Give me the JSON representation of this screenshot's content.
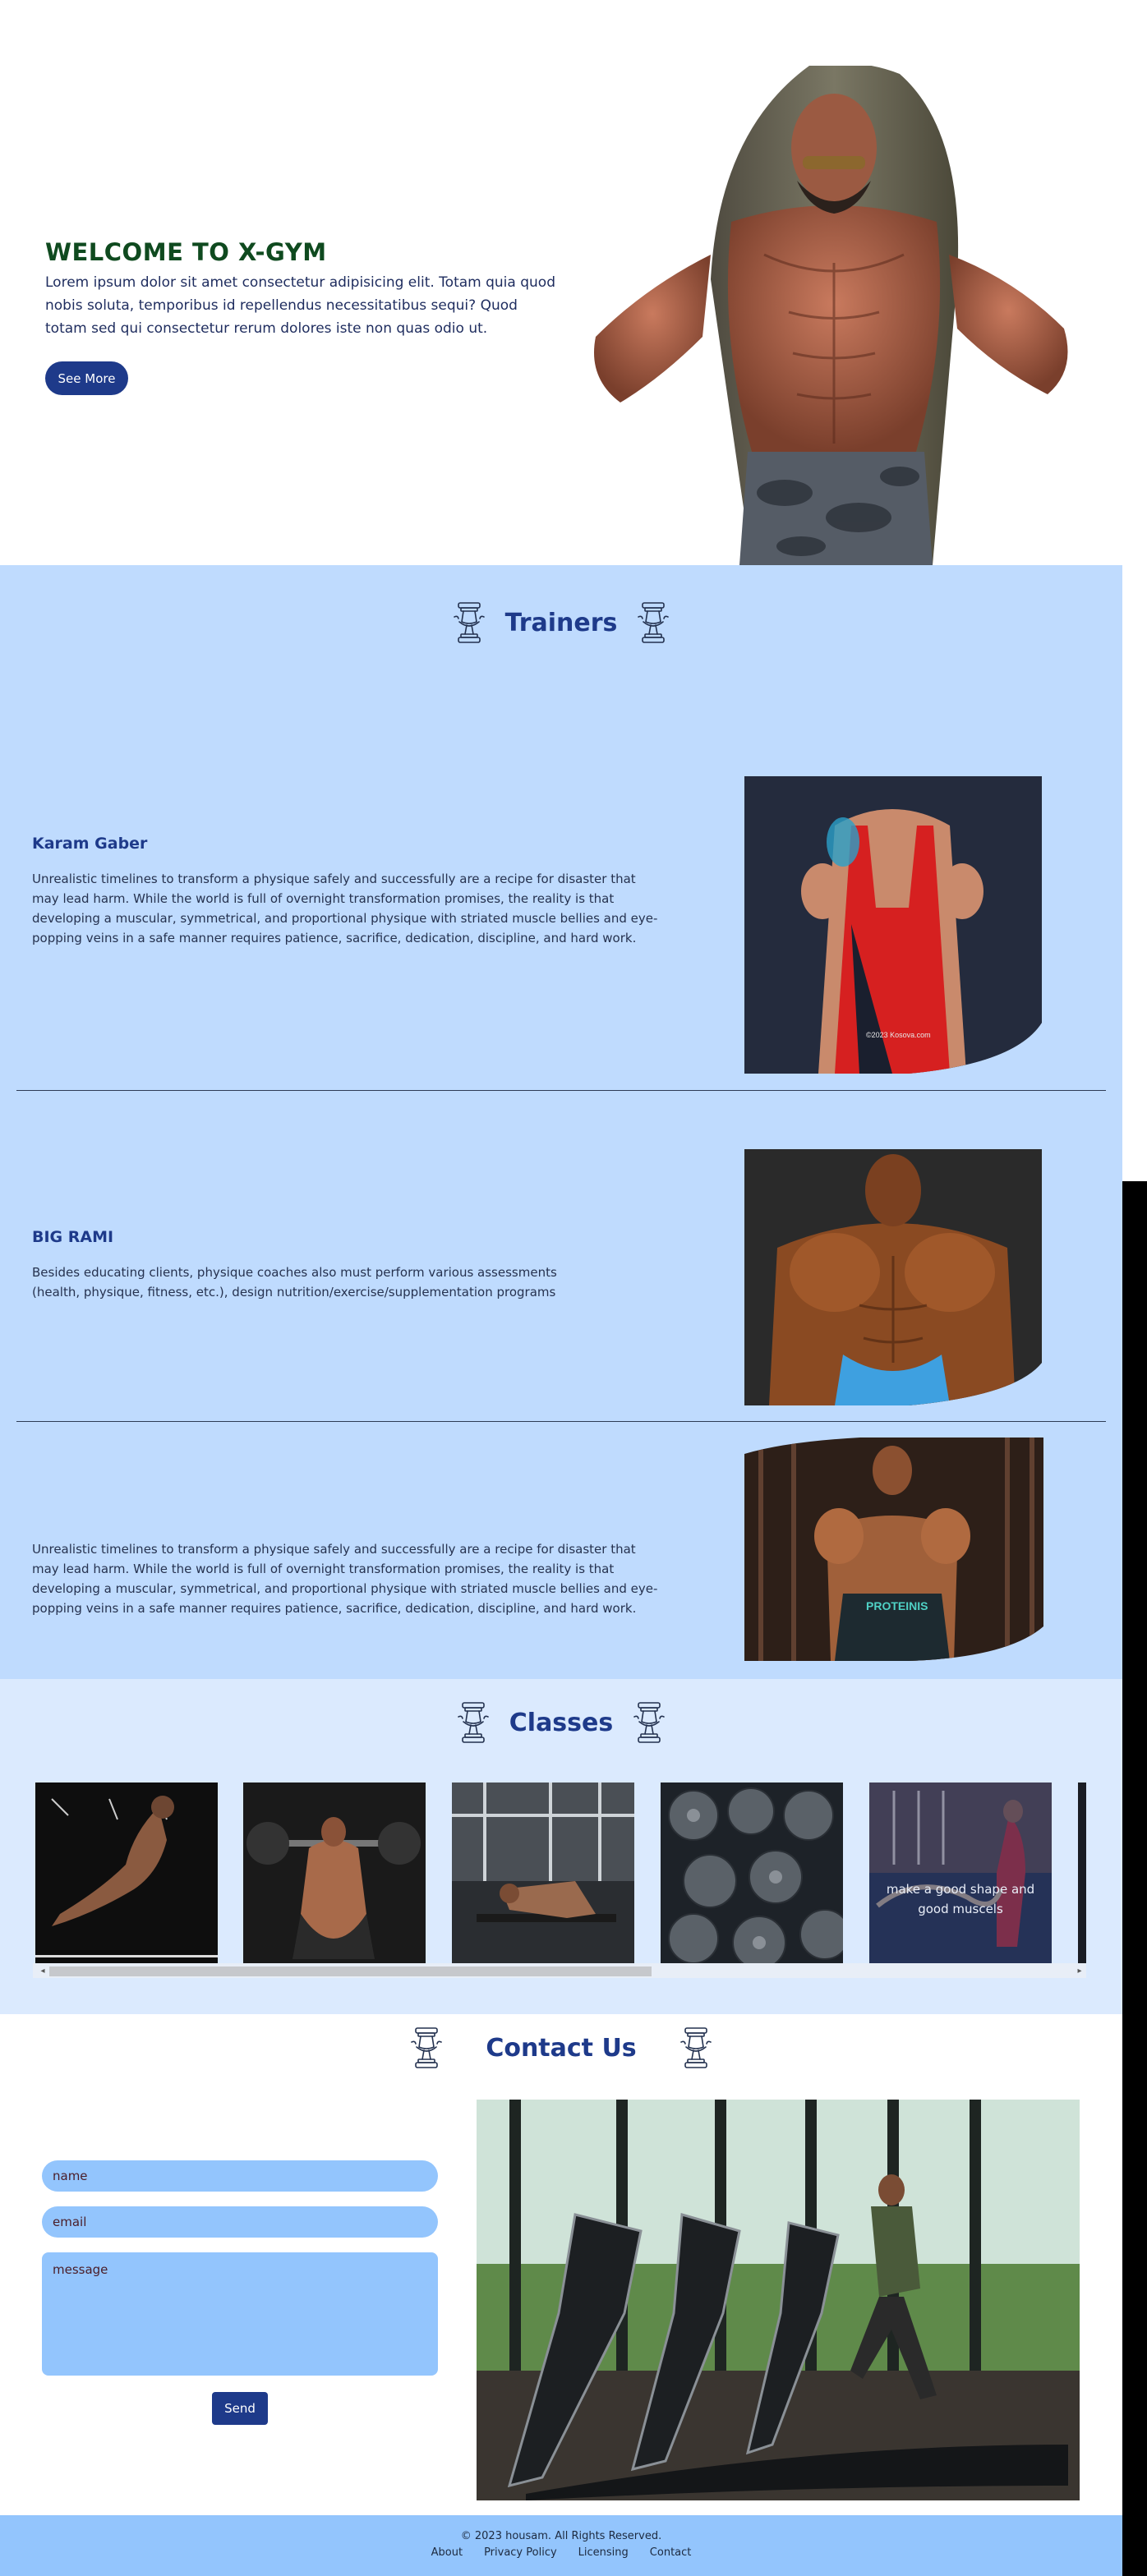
{
  "hero": {
    "title": "WELCOME TO X-GYM",
    "text": "Lorem ipsum dolor sit amet consectetur adipisicing elit. Totam quia quod nobis soluta, temporibus id repellendus necessitatibus sequi? Quod totam sed qui consectetur rerum dolores iste non quas odio ut.",
    "button_label": "See More"
  },
  "trainers": {
    "title": "Trainers",
    "items": [
      {
        "name": "Karam Gaber",
        "text": "Unrealistic timelines to transform a physique safely and successfully are a recipe for disaster that may lead harm. While the world is full of overnight transformation promises, the reality is that developing a muscular, symmetrical, and proportional physique with striated muscle bellies and eye-popping veins in a safe manner requires patience, sacrifice, dedication, discipline, and hard work.",
        "photo_caption": "©2023 Kosova.com"
      },
      {
        "name": "BIG RAMI",
        "text": "Besides educating clients, physique coaches also must perform various assessments (health, physique, fitness, etc.), design nutrition/exercise/supplementation programs"
      },
      {
        "name": "",
        "text": "Unrealistic timelines to transform a physique safely and successfully are a recipe for disaster that may lead harm. While the world is full of overnight transformation promises, the reality is that developing a muscular, symmetrical, and proportional physique with striated muscle bellies and eye-popping veins in a safe manner requires patience, sacrifice, dedication, discipline, and hard work.",
        "shorts_text": "PROTEINIS"
      }
    ]
  },
  "classes": {
    "title": "Classes",
    "card_overlay_text": "make a good shape and good muscels"
  },
  "contact": {
    "title": "Contact Us",
    "name_placeholder": "name",
    "email_placeholder": "email",
    "message_placeholder": "message",
    "send_label": "Send"
  },
  "footer": {
    "copyright": "© 2023 housam. All Rights Reserved.",
    "links": [
      "About",
      "Privacy Policy",
      "Licensing",
      "Contact"
    ]
  },
  "colors": {
    "accent": "#1e3a8a",
    "hero_title": "#0f4a1f",
    "trainers_bg": "#bfdbfe",
    "classes_bg": "#dbeafe",
    "field_bg": "#93c5fd"
  },
  "icons": [
    "dumbbell-icon"
  ]
}
